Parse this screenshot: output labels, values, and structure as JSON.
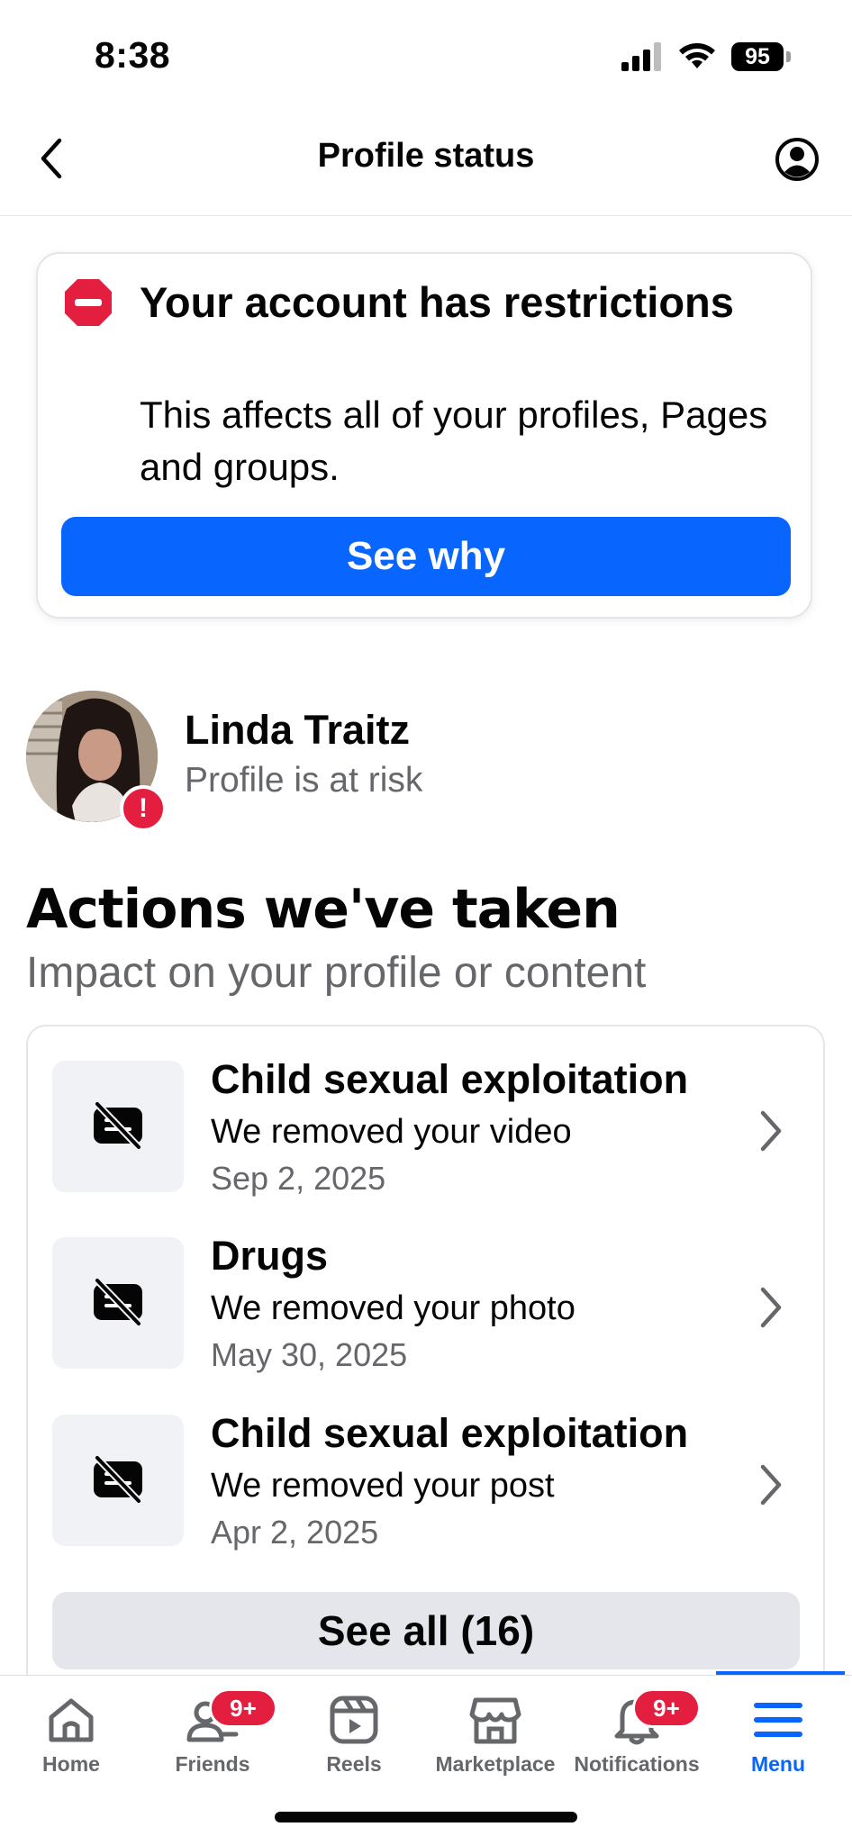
{
  "status_bar": {
    "time": "8:38",
    "battery": "95"
  },
  "header": {
    "title": "Profile status",
    "back_icon": "chevron-left-icon",
    "account_icon": "user-circle-icon"
  },
  "restriction": {
    "icon": "no-entry-icon",
    "title": "Your account has restrictions",
    "description": "This affects all of your profiles, Pages and groups.",
    "button_label": "See why"
  },
  "profile": {
    "name": "Linda Traitz",
    "status": "Profile is at risk",
    "warning_badge": "!"
  },
  "actions": {
    "heading": "Actions we've taken",
    "subheading": "Impact on your profile or content",
    "items": [
      {
        "title": "Child sexual exploitation",
        "subtitle": "We removed your video",
        "date": "Sep 2, 2025"
      },
      {
        "title": "Drugs",
        "subtitle": "We removed your photo",
        "date": "May 30, 2025"
      },
      {
        "title": "Child sexual exploitation",
        "subtitle": "We removed your post",
        "date": "Apr 2, 2025"
      }
    ],
    "see_all_label": "See all (16)"
  },
  "bottom_nav": {
    "items": [
      {
        "label": "Home",
        "icon": "home-icon"
      },
      {
        "label": "Friends",
        "icon": "friends-icon",
        "badge": "9+"
      },
      {
        "label": "Reels",
        "icon": "reels-icon"
      },
      {
        "label": "Marketplace",
        "icon": "marketplace-icon"
      },
      {
        "label": "Notifications",
        "icon": "bell-icon",
        "badge": "9+"
      },
      {
        "label": "Menu",
        "icon": "menu-icon",
        "active": true
      }
    ]
  },
  "colors": {
    "brand_blue": "#0866ff",
    "alert_red": "#e41e3f",
    "secondary_text": "#65676b"
  }
}
